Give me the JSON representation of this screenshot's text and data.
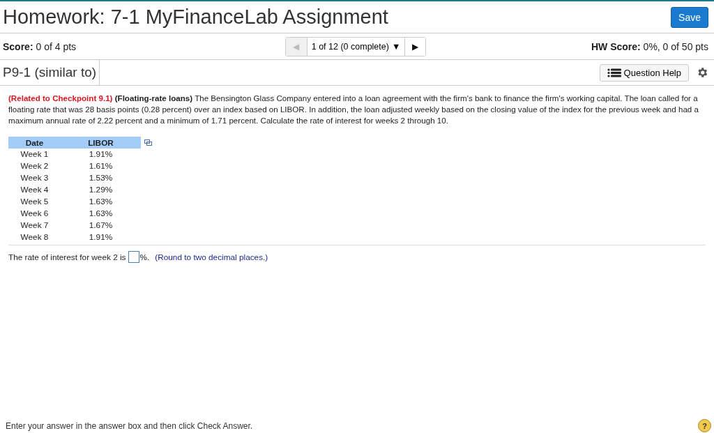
{
  "header": {
    "title": "Homework: 7-1 MyFinanceLab Assignment",
    "save_button": "Save"
  },
  "score_bar": {
    "score_label": "Score:",
    "score_value": "0 of 4 pts",
    "pager": {
      "prev_icon": "◀",
      "position": "1 of 12 (0 complete)",
      "menu_icon": "▼",
      "next_icon": "▶"
    },
    "hw_score_label": "HW Score:",
    "hw_score_value": "0%, 0 of 50 pts"
  },
  "question_bar": {
    "title": "P9-1 (similar to)",
    "help_button": "Question Help"
  },
  "question": {
    "text": "**(Related to Checkpoint 9.1)** **(Floating-rate loans)** The Bensington Glass Company entered into a loan agreement with the firm's bank to finance the firm's working capital. The loan called for a floating rate that was 28 basis points (0.28 percent) over an index based on LIBOR. In addition, the loan adjusted weekly based on the closing value of the index for the previous week and had a maximum annual rate of 2.22 percent and a minimum of 1.71 percent. Calculate the rate of interest for weeks 2 through 10.",
    "table": {
      "columns": [
        "Date",
        "LIBOR"
      ],
      "rows": [
        [
          "Week 1",
          "1.91%"
        ],
        [
          "Week 2",
          "1.61%"
        ],
        [
          "Week 3",
          "1.53%"
        ],
        [
          "Week 4",
          "1.29%"
        ],
        [
          "Week 5",
          "1.63%"
        ],
        [
          "Week 6",
          "1.63%"
        ],
        [
          "Week 7",
          "1.67%"
        ],
        [
          "Week 8",
          "1.91%"
        ]
      ]
    },
    "answer": {
      "prefix": "The rate of interest for week 2 is",
      "suffix": "%.",
      "hint": "(Round to two decimal places.)"
    }
  },
  "footer": {
    "instruction": "Enter your answer in the answer box and then click Check Answer.",
    "help_icon": "?"
  }
}
